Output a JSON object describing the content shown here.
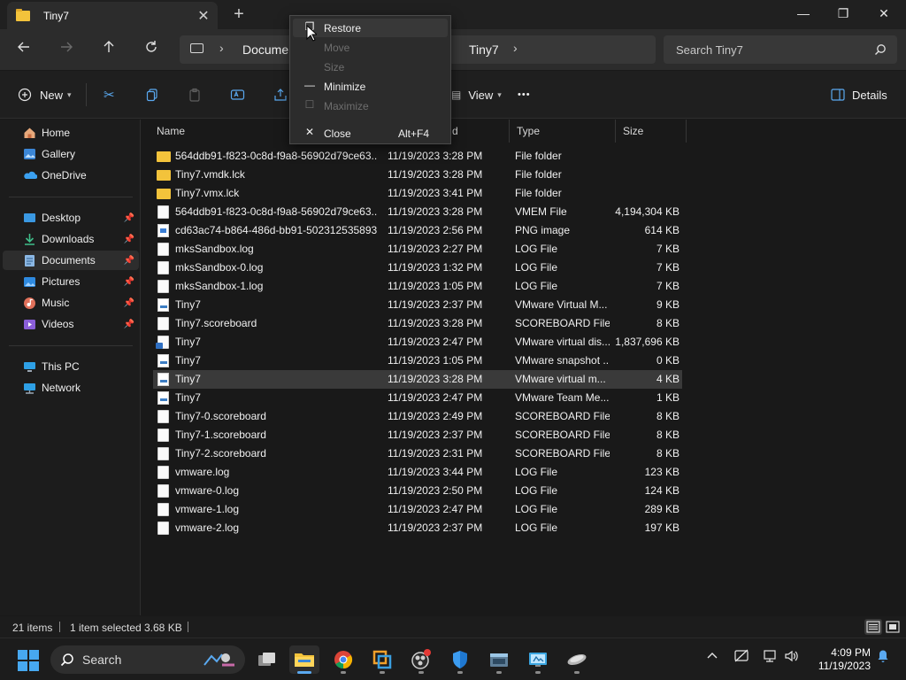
{
  "window": {
    "tab_title": "Tiny7",
    "new_tab": "+",
    "minimize": "—",
    "maximize": "❐",
    "close": "✕"
  },
  "addressbar": {
    "crumbs": [
      "Docume",
      "Tiny7"
    ],
    "search_placeholder": "Search Tiny7"
  },
  "toolbar": {
    "new_label": "New",
    "view_label": "View",
    "more_label": "•••",
    "details_label": "Details"
  },
  "sidebar": {
    "items": [
      {
        "label": "Home",
        "icon": "home-icon"
      },
      {
        "label": "Gallery",
        "icon": "gallery-icon"
      },
      {
        "label": "OneDrive",
        "icon": "onedrive-icon"
      },
      {
        "label": "Desktop",
        "icon": "desktop-icon",
        "pinned": true
      },
      {
        "label": "Downloads",
        "icon": "downloads-icon",
        "pinned": true
      },
      {
        "label": "Documents",
        "icon": "documents-icon",
        "pinned": true,
        "selected": true
      },
      {
        "label": "Pictures",
        "icon": "pictures-icon",
        "pinned": true
      },
      {
        "label": "Music",
        "icon": "music-icon",
        "pinned": true
      },
      {
        "label": "Videos",
        "icon": "videos-icon",
        "pinned": true
      },
      {
        "label": "This PC",
        "icon": "this-pc-icon"
      },
      {
        "label": "Network",
        "icon": "network-icon"
      }
    ]
  },
  "columns": {
    "name": "Name",
    "date": "d",
    "type": "Type",
    "size": "Size"
  },
  "files": [
    {
      "name": "564ddb91-f823-0c8d-f9a8-56902d79ce63....",
      "date": "11/19/2023 3:28 PM",
      "type": "File folder",
      "size": "",
      "icon": "folder"
    },
    {
      "name": "Tiny7.vmdk.lck",
      "date": "11/19/2023 3:28 PM",
      "type": "File folder",
      "size": "",
      "icon": "folder"
    },
    {
      "name": "Tiny7.vmx.lck",
      "date": "11/19/2023 3:41 PM",
      "type": "File folder",
      "size": "",
      "icon": "folder"
    },
    {
      "name": "564ddb91-f823-0c8d-f9a8-56902d79ce63....",
      "date": "11/19/2023 3:28 PM",
      "type": "VMEM File",
      "size": "4,194,304 KB",
      "icon": "file"
    },
    {
      "name": "cd63ac74-b864-486d-bb91-502312535893",
      "date": "11/19/2023 2:56 PM",
      "type": "PNG image",
      "size": "614 KB",
      "icon": "png"
    },
    {
      "name": "mksSandbox.log",
      "date": "11/19/2023 2:27 PM",
      "type": "LOG File",
      "size": "7 KB",
      "icon": "file"
    },
    {
      "name": "mksSandbox-0.log",
      "date": "11/19/2023 1:32 PM",
      "type": "LOG File",
      "size": "7 KB",
      "icon": "file"
    },
    {
      "name": "mksSandbox-1.log",
      "date": "11/19/2023 1:05 PM",
      "type": "LOG File",
      "size": "7 KB",
      "icon": "file"
    },
    {
      "name": "Tiny7",
      "date": "11/19/2023 2:37 PM",
      "type": "VMware Virtual M...",
      "size": "9 KB",
      "icon": "vm"
    },
    {
      "name": "Tiny7.scoreboard",
      "date": "11/19/2023 3:28 PM",
      "type": "SCOREBOARD File",
      "size": "8 KB",
      "icon": "file"
    },
    {
      "name": "Tiny7",
      "date": "11/19/2023 2:47 PM",
      "type": "VMware virtual dis...",
      "size": "1,837,696 KB",
      "icon": "disk"
    },
    {
      "name": "Tiny7",
      "date": "11/19/2023 1:05 PM",
      "type": "VMware snapshot ...",
      "size": "0 KB",
      "icon": "vm"
    },
    {
      "name": "Tiny7",
      "date": "11/19/2023 3:28 PM",
      "type": "VMware virtual m...",
      "size": "4 KB",
      "icon": "vm",
      "selected": true
    },
    {
      "name": "Tiny7",
      "date": "11/19/2023 2:47 PM",
      "type": "VMware Team Me...",
      "size": "1 KB",
      "icon": "vm"
    },
    {
      "name": "Tiny7-0.scoreboard",
      "date": "11/19/2023 2:49 PM",
      "type": "SCOREBOARD File",
      "size": "8 KB",
      "icon": "file"
    },
    {
      "name": "Tiny7-1.scoreboard",
      "date": "11/19/2023 2:37 PM",
      "type": "SCOREBOARD File",
      "size": "8 KB",
      "icon": "file"
    },
    {
      "name": "Tiny7-2.scoreboard",
      "date": "11/19/2023 2:31 PM",
      "type": "SCOREBOARD File",
      "size": "8 KB",
      "icon": "file"
    },
    {
      "name": "vmware.log",
      "date": "11/19/2023 3:44 PM",
      "type": "LOG File",
      "size": "123 KB",
      "icon": "file"
    },
    {
      "name": "vmware-0.log",
      "date": "11/19/2023 2:50 PM",
      "type": "LOG File",
      "size": "124 KB",
      "icon": "file"
    },
    {
      "name": "vmware-1.log",
      "date": "11/19/2023 2:47 PM",
      "type": "LOG File",
      "size": "289 KB",
      "icon": "file"
    },
    {
      "name": "vmware-2.log",
      "date": "11/19/2023 2:37 PM",
      "type": "LOG File",
      "size": "197 KB",
      "icon": "file"
    }
  ],
  "status": {
    "item_count": "21 items",
    "selection": "1 item selected",
    "selection_size": "3.68 KB"
  },
  "context_menu": {
    "items": [
      {
        "label": "Restore",
        "icon": "restore-icon",
        "enabled": true,
        "highlighted": true
      },
      {
        "label": "Move",
        "icon": "",
        "enabled": false
      },
      {
        "label": "Size",
        "icon": "",
        "enabled": false
      },
      {
        "label": "Minimize",
        "icon": "minimize-icon",
        "enabled": true
      },
      {
        "label": "Maximize",
        "icon": "maximize-icon",
        "enabled": false
      },
      {
        "label": "Close",
        "icon": "close-icon",
        "enabled": true,
        "accelerator": "Alt+F4"
      }
    ]
  },
  "taskbar": {
    "search_label": "Search",
    "time": "4:09 PM",
    "date": "11/19/2023"
  },
  "colors": {
    "accent": "#5aa9f0",
    "folder": "#f3c33b",
    "background": "#191919"
  }
}
